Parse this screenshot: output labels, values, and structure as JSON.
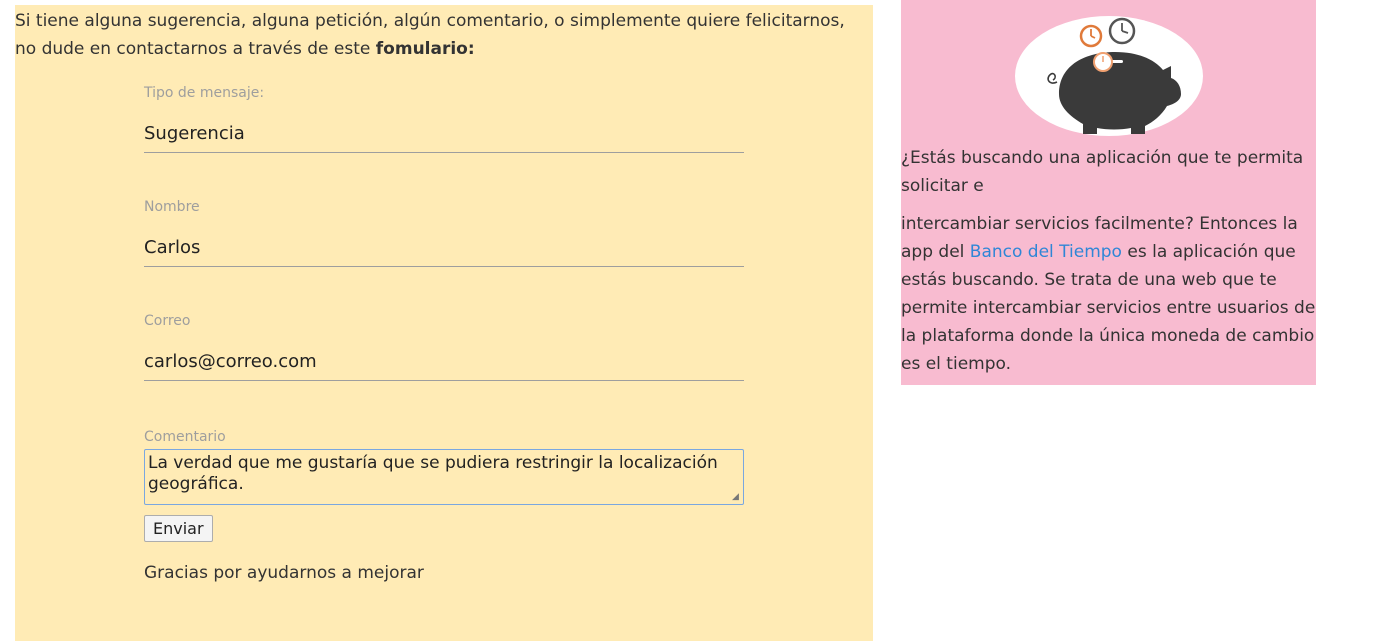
{
  "intro": {
    "text": "Si tiene alguna sugerencia, alguna petición, algún comentario, o simplemente quiere felicitarnos, no dude en contactarnos a través de este ",
    "bold": "fomulario:"
  },
  "form": {
    "tipo_label": "Tipo de mensaje:",
    "tipo_value": "Sugerencia",
    "nombre_label": "Nombre",
    "nombre_value": "Carlos",
    "correo_label": "Correo",
    "correo_value": "carlos@correo.com",
    "comentario_label": "Comentario",
    "comentario_value": "La verdad que me gustaría que se pudiera restringir la localización geográfica.",
    "submit_label": "Enviar",
    "thanks": "Gracias por ayudarnos a mejorar"
  },
  "info": {
    "para1": "¿Estás buscando una aplicación que te permita solicitar e",
    "para2_before": "intercambiar servicios facilmente? Entonces la app del ",
    "link_text": "Banco del Tiempo",
    "para2_after": " es la aplicación que estás buscando. Se trata de una web que te permite intercambiar servicios entre usuarios de la plataforma donde la única moneda de cambio es el tiempo.",
    "image_icon": "piggy-bank-clocks-icon"
  },
  "colors": {
    "form_bg": "#ffebb5",
    "info_bg": "#f8bbd0",
    "link": "#2f86d6",
    "focus_border": "#7aa7e0"
  }
}
